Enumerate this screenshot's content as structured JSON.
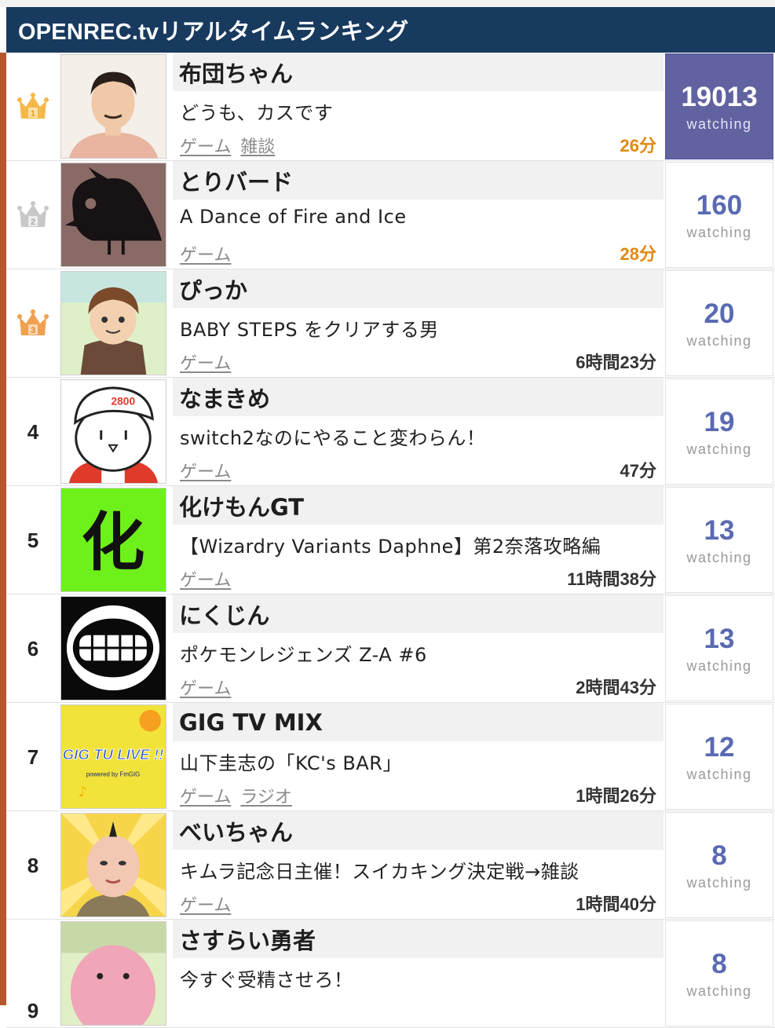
{
  "header": {
    "title": "OPENREC.tvリアルタイムランキング"
  },
  "colors": {
    "header_bg": "#173a5e",
    "accent_bar": "#b5562e",
    "top_viewer_bg": "#6162a0",
    "viewer_count": "#5a6ab2",
    "recent_elapsed": "#e08a10"
  },
  "ranking": [
    {
      "rank": "1",
      "crown": "gold-crown-icon",
      "thumbnail": "avatar-man-photo",
      "name": "布団ちゃん",
      "title": "どうも、カスです",
      "tags": [
        "ゲーム",
        "雑談"
      ],
      "elapsed": "26分",
      "viewers": "19013",
      "unit": "watching"
    },
    {
      "rank": "2",
      "crown": "silver-crown-icon",
      "thumbnail": "avatar-bird-logo",
      "name": "とりバード",
      "title": "A Dance of Fire and Ice",
      "tags": [
        "ゲーム"
      ],
      "elapsed": "28分",
      "viewers": "160",
      "unit": "watching"
    },
    {
      "rank": "3",
      "crown": "bronze-crown-icon",
      "thumbnail": "avatar-illustration",
      "name": "ぴっか",
      "title": "BABY STEPS をクリアする男",
      "tags": [
        "ゲーム"
      ],
      "elapsed": "6時間23分",
      "viewers": "20",
      "unit": "watching"
    },
    {
      "rank": "4",
      "thumbnail": "avatar-cap-character",
      "thumb_text": "2800",
      "name": "なまきめ",
      "title": "switch2なのにやること変わらん！",
      "tags": [
        "ゲーム"
      ],
      "elapsed": "47分",
      "viewers": "19",
      "unit": "watching"
    },
    {
      "rank": "5",
      "thumbnail": "avatar-kanji-logo",
      "thumb_text": "化",
      "name": "化けもんGT",
      "title": "【Wizardry Variants Daphne】第2奈落攻略編",
      "tags": [
        "ゲーム"
      ],
      "elapsed": "11時間38分",
      "viewers": "13",
      "unit": "watching"
    },
    {
      "rank": "6",
      "thumbnail": "avatar-teeth-logo",
      "name": "にくじん",
      "title": "ポケモンレジェンズ Z-A #6",
      "tags": [
        "ゲーム"
      ],
      "elapsed": "2時間43分",
      "viewers": "13",
      "unit": "watching"
    },
    {
      "rank": "7",
      "thumbnail": "avatar-gigtv-logo",
      "thumb_text": "GIG TU LIVE !!",
      "thumb_subtext": "powered by FmGIG",
      "name": "GIG TV MIX",
      "title": "山下圭志の「KC's BAR」",
      "tags": [
        "ゲーム",
        "ラジオ"
      ],
      "elapsed": "1時間26分",
      "viewers": "12",
      "unit": "watching"
    },
    {
      "rank": "8",
      "thumbnail": "avatar-face-photo",
      "name": "べいちゃん",
      "title": "キムラ記念日主催！スイカキング決定戦→雑談",
      "tags": [
        "ゲーム"
      ],
      "elapsed": "1時間40分",
      "viewers": "8",
      "unit": "watching"
    },
    {
      "rank": "9",
      "thumbnail": "avatar-pink-blob",
      "name": "さすらい勇者",
      "title": "今すぐ受精させろ！",
      "tags": [],
      "elapsed": "",
      "viewers": "8",
      "unit": "watching"
    }
  ]
}
